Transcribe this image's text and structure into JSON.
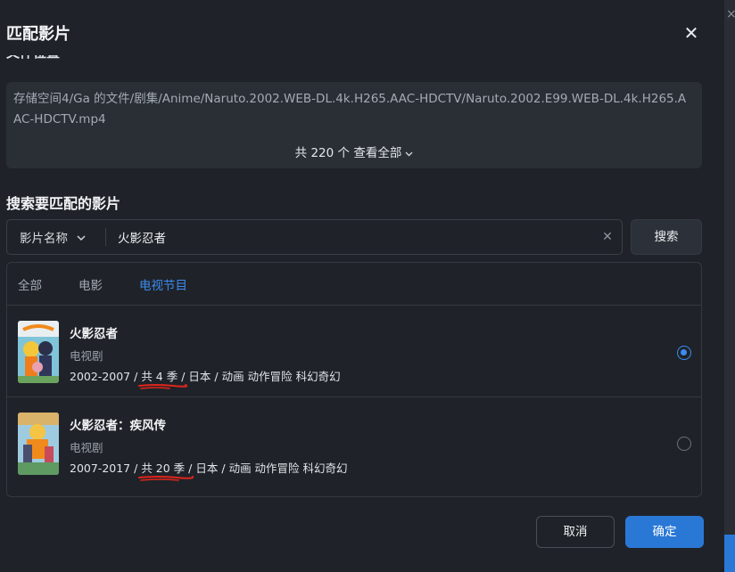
{
  "dialog": {
    "title": "匹配影片",
    "close_icon": "close-icon",
    "file_section_heading": "文件位置"
  },
  "file": {
    "path": "存储空间4/Ga 的文件/剧集/Anime/Naruto.2002.WEB-DL.4k.H265.AAC-HDCTV/Naruto.2002.E99.WEB-DL.4k.H265.AAC-HDCTV.mp4",
    "show_all": "共 220 个 查看全部",
    "show_all_icon": "chevron-down-icon"
  },
  "search": {
    "heading": "搜索要匹配的影片",
    "type_label": "影片名称",
    "query": "火影忍者",
    "clear_icon": "clear-icon",
    "button": "搜索"
  },
  "tabs": [
    {
      "label": "全部",
      "active": false
    },
    {
      "label": "电影",
      "active": false
    },
    {
      "label": "电视节目",
      "active": true
    }
  ],
  "results": [
    {
      "title": "火影忍者",
      "category": "电视剧",
      "years": "2002-2007",
      "seasons": "共 4 季",
      "country": "日本",
      "genres": "动画 动作冒险 科幻奇幻",
      "selected": true
    },
    {
      "title": "火影忍者：疾风传",
      "category": "电视剧",
      "years": "2007-2017",
      "seasons": "共 20 季",
      "country": "日本",
      "genres": "动画 动作冒险 科幻奇幻",
      "selected": false
    }
  ],
  "footer": {
    "cancel": "取消",
    "confirm": "确定"
  },
  "colors": {
    "accent": "#3d8bf0",
    "primary_button": "#2a78d6",
    "annotation_red": "#e0241b"
  },
  "separator": "/"
}
